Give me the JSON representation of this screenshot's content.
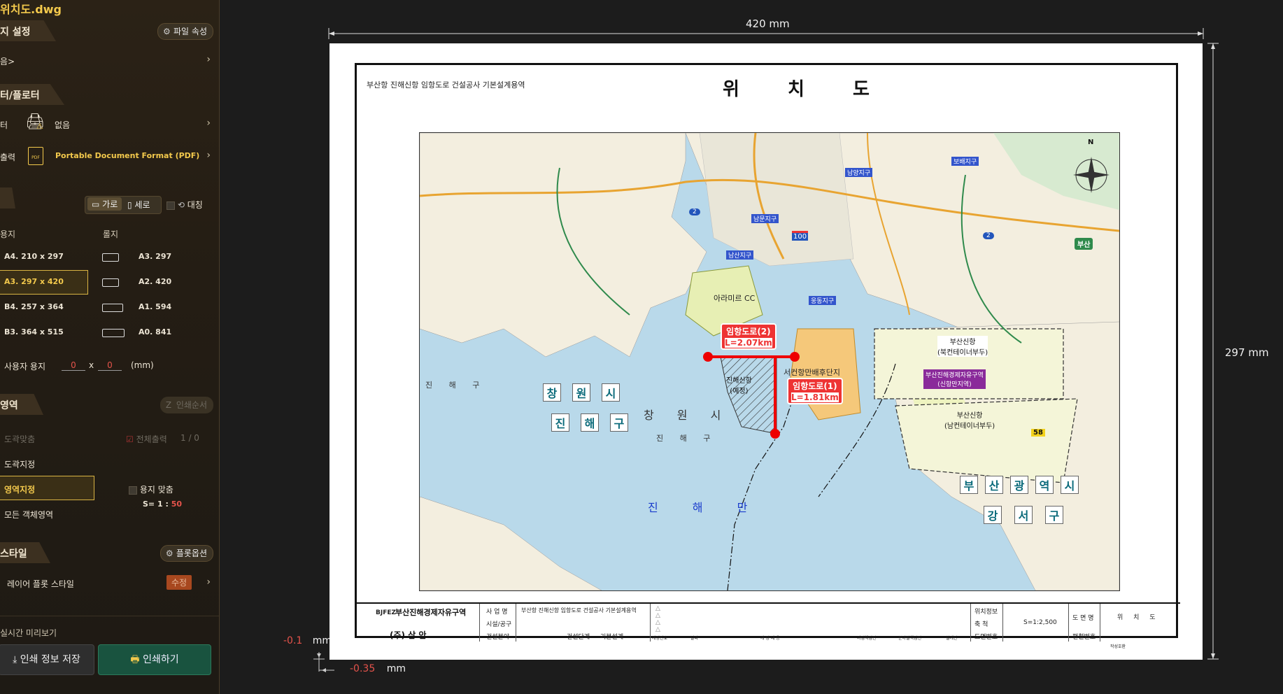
{
  "file": {
    "name": "위치도.dwg"
  },
  "sidebar": {
    "page_setup": {
      "label": "지 설정",
      "button": "파일 속성",
      "value": "음>"
    },
    "plotter": {
      "label": "터/플로터",
      "printer_label": "터",
      "printer_value": "없음",
      "output_label": "출력",
      "output_value": "Portable Document Format (PDF)"
    },
    "paper": {
      "landscape": "가로",
      "portrait": "세로",
      "mirror": "대칭",
      "sheet_header": "용지",
      "roll_header": "롤지",
      "sheets": [
        "A4. 210 x 297",
        "A3. 297 x 420",
        "B4. 257 x 364",
        "B3. 364 x 515"
      ],
      "rolls": [
        "A3. 297",
        "A2. 420",
        "A1. 594",
        "A0. 841"
      ],
      "selected_sheet": "A3. 297 x 420",
      "custom_label": "사용자 용지",
      "custom_w": "0",
      "custom_x": "x",
      "custom_h": "0",
      "custom_unit": "(mm)"
    },
    "area": {
      "label": "영역",
      "order_button": "인쇄순서",
      "options": [
        "도곽맞춤",
        "도곽지정",
        "영역지정",
        "모든 객체영역"
      ],
      "selected": "영역지정",
      "print_all": "전체출력",
      "print_all_count": "1 / 0",
      "fit_paper": "용지 맞춤",
      "scale_label": "S= 1 :",
      "scale_value": "50"
    },
    "style": {
      "label": "스타일",
      "button": "플롯옵션",
      "layer_label": "레이어 플롯 스타일",
      "edit_button": "수정"
    },
    "preview_label": "실시간 미리보기",
    "save_button": "인쇄 정보 저장",
    "print_button": "인쇄하기"
  },
  "preview": {
    "width_dim": "420 mm",
    "height_dim": "297 mm",
    "offset_y": "-0.1",
    "offset_x": "-0.35",
    "unit": "mm",
    "project_name": "부산항 진해신항 임항도로 건설공사 기본설계용역",
    "title": "위 치 도",
    "map_labels": {
      "road2": "임항도로(2)",
      "road2_len": "L=2.07km",
      "road1": "임항도로(1)",
      "road1_len": "L=1.81km",
      "changwon": [
        "창",
        "원",
        "시"
      ],
      "jinhae": [
        "진",
        "해",
        "구"
      ],
      "busan": [
        "부",
        "산",
        "광",
        "역",
        "시"
      ],
      "gangseo": [
        "강",
        "서",
        "구"
      ],
      "bay": "진 해 만",
      "arami": "아라미르 CC",
      "newport_n": "부산신항\n(북컨테이너부두)",
      "newport_s": "부산신항\n(남컨테이너부두)",
      "fez": "부산진해경제자유구역\n(신항만지역)",
      "seo": "서컨항만배후단지",
      "jinhae_port": "진해신항\n(예정)",
      "namsan": "남산지구",
      "namyang": "남양지구",
      "nammun": "남문지구",
      "ungdong": "웅동지구",
      "bobae": "보배지구",
      "changwon_small": "창 원 시",
      "jinhae_small": "진 해 구",
      "jinhae_left": "진 해 구",
      "route2a": "2",
      "route2b": "2",
      "route100": "100",
      "route58": "58",
      "busan_sign": "부산",
      "north": "N"
    },
    "title_block": {
      "logo": "BJFEZ",
      "org": "부산진해경제자유구역",
      "company": "(주) 삼 안",
      "project_label": "사 업 명",
      "project_value": "부산항 진해신항 임항도로 건설공사 기본설계용역",
      "owner_label": "시설/공구",
      "field_label": "건설분야",
      "stage_label": "건설단계",
      "stage_value": "기본설계",
      "rev_headers": [
        "개정번호",
        "날짜",
        "개 정 내 용",
        "과업책임인",
        "분야별책임인",
        "설계인"
      ],
      "loc_label": "위치정보",
      "scale_label": "축 척",
      "scale_value": "S=1:2,500",
      "dwgno_label": "도면번호",
      "dwgname_label": "도 면 명",
      "dwgname_value": "위 치 도",
      "edit_label": "편철번호",
      "extra": "작성호환"
    }
  }
}
